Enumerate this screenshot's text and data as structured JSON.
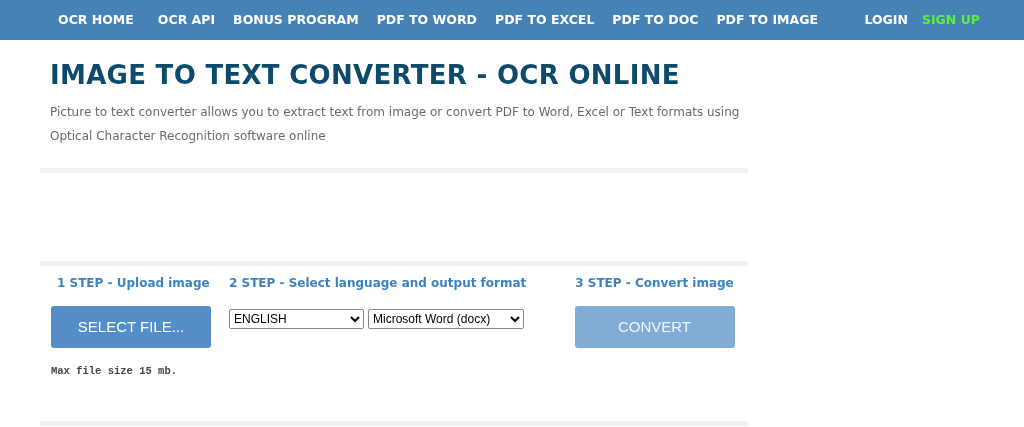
{
  "nav": {
    "items": [
      "OCR HOME",
      "OCR API",
      "BONUS PROGRAM",
      "PDF TO WORD",
      "PDF TO EXCEL",
      "PDF TO DOC",
      "PDF TO IMAGE"
    ],
    "login": "LOGIN",
    "signup": "SIGN UP"
  },
  "title": "IMAGE TO TEXT CONVERTER - OCR ONLINE",
  "description": "Picture to text converter allows you to extract text from image or convert PDF to Word, Excel or Text formats using Optical Character Recognition software online",
  "steps": [
    {
      "label": "1 STEP - Upload image",
      "button": "SELECT FILE...",
      "note": "Max file size 15 mb."
    },
    {
      "label": "2 STEP - Select language and output format",
      "language": "ENGLISH",
      "format": "Microsoft Word (docx)"
    },
    {
      "label": "3 STEP - Convert image",
      "button": "CONVERT",
      "disabled": true
    }
  ]
}
